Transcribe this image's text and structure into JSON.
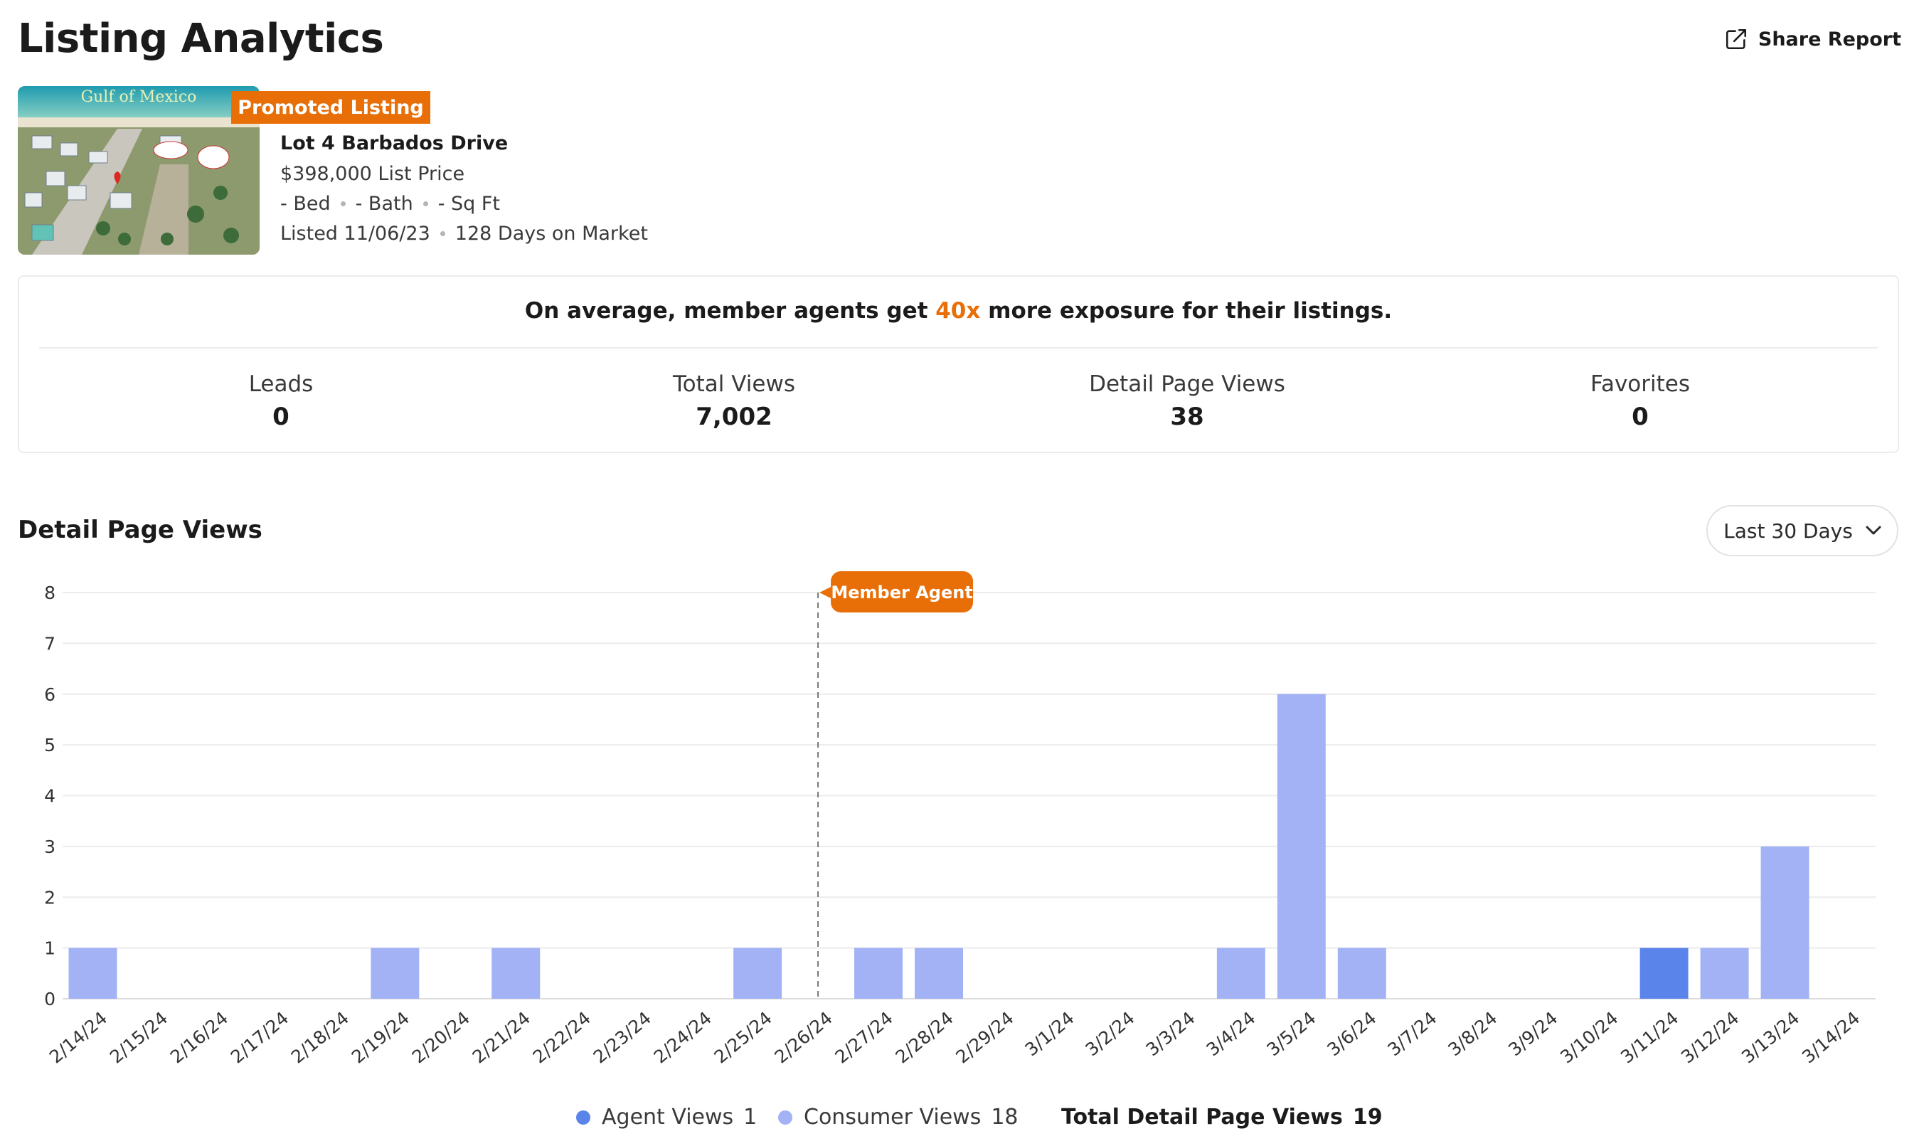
{
  "header": {
    "title": "Listing Analytics",
    "share_label": "Share Report"
  },
  "listing": {
    "photo_caption": "Gulf of Mexico",
    "badge": "Promoted Listing",
    "address": "Lot 4 Barbados Drive",
    "price": "$398,000 List Price",
    "bed": "- Bed",
    "bath": "- Bath",
    "sqft": "- Sq Ft",
    "listed": "Listed 11/06/23",
    "days": "128 Days on Market"
  },
  "promo": {
    "before": "On average, member agents get ",
    "accent": "40x",
    "after": " more exposure for their listings.",
    "accent_color": "#e86f08"
  },
  "stats": [
    {
      "label": "Leads",
      "value": "0"
    },
    {
      "label": "Total Views",
      "value": "7,002"
    },
    {
      "label": "Detail Page Views",
      "value": "38"
    },
    {
      "label": "Favorites",
      "value": "0"
    }
  ],
  "section": {
    "title": "Detail Page Views",
    "range_label": "Last 30 Days"
  },
  "chart_data": {
    "type": "bar",
    "stacked": true,
    "categories": [
      "2/14/24",
      "2/15/24",
      "2/16/24",
      "2/17/24",
      "2/18/24",
      "2/19/24",
      "2/20/24",
      "2/21/24",
      "2/22/24",
      "2/23/24",
      "2/24/24",
      "2/25/24",
      "2/26/24",
      "2/27/24",
      "2/28/24",
      "2/29/24",
      "3/1/24",
      "3/2/24",
      "3/3/24",
      "3/4/24",
      "3/5/24",
      "3/6/24",
      "3/7/24",
      "3/8/24",
      "3/9/24",
      "3/10/24",
      "3/11/24",
      "3/12/24",
      "3/13/24",
      "3/14/24"
    ],
    "series": [
      {
        "name": "Agent Views",
        "color": "#5b84ea",
        "values": [
          0,
          0,
          0,
          0,
          0,
          0,
          0,
          0,
          0,
          0,
          0,
          0,
          0,
          0,
          0,
          0,
          0,
          0,
          0,
          0,
          0,
          0,
          0,
          0,
          0,
          0,
          1,
          0,
          0,
          0
        ]
      },
      {
        "name": "Consumer Views",
        "color": "#a2b2f5",
        "values": [
          1,
          0,
          0,
          0,
          0,
          1,
          0,
          1,
          0,
          0,
          0,
          1,
          0,
          1,
          1,
          0,
          0,
          0,
          0,
          1,
          6,
          1,
          0,
          0,
          0,
          0,
          0,
          1,
          3,
          0
        ]
      }
    ],
    "ylim": [
      0,
      8
    ],
    "yticks": [
      0,
      1,
      2,
      3,
      4,
      5,
      6,
      7,
      8
    ],
    "grid": true,
    "annotation": {
      "label": "Member Agent",
      "at": "2/26/24",
      "color": "#e86f08"
    }
  },
  "legend": {
    "agent_label": "Agent Views",
    "agent_count": "1",
    "agent_color": "#5b84ea",
    "consumer_label": "Consumer Views",
    "consumer_count": "18",
    "consumer_color": "#a2b2f5",
    "total_label": "Total Detail Page Views",
    "total_count": "19"
  }
}
